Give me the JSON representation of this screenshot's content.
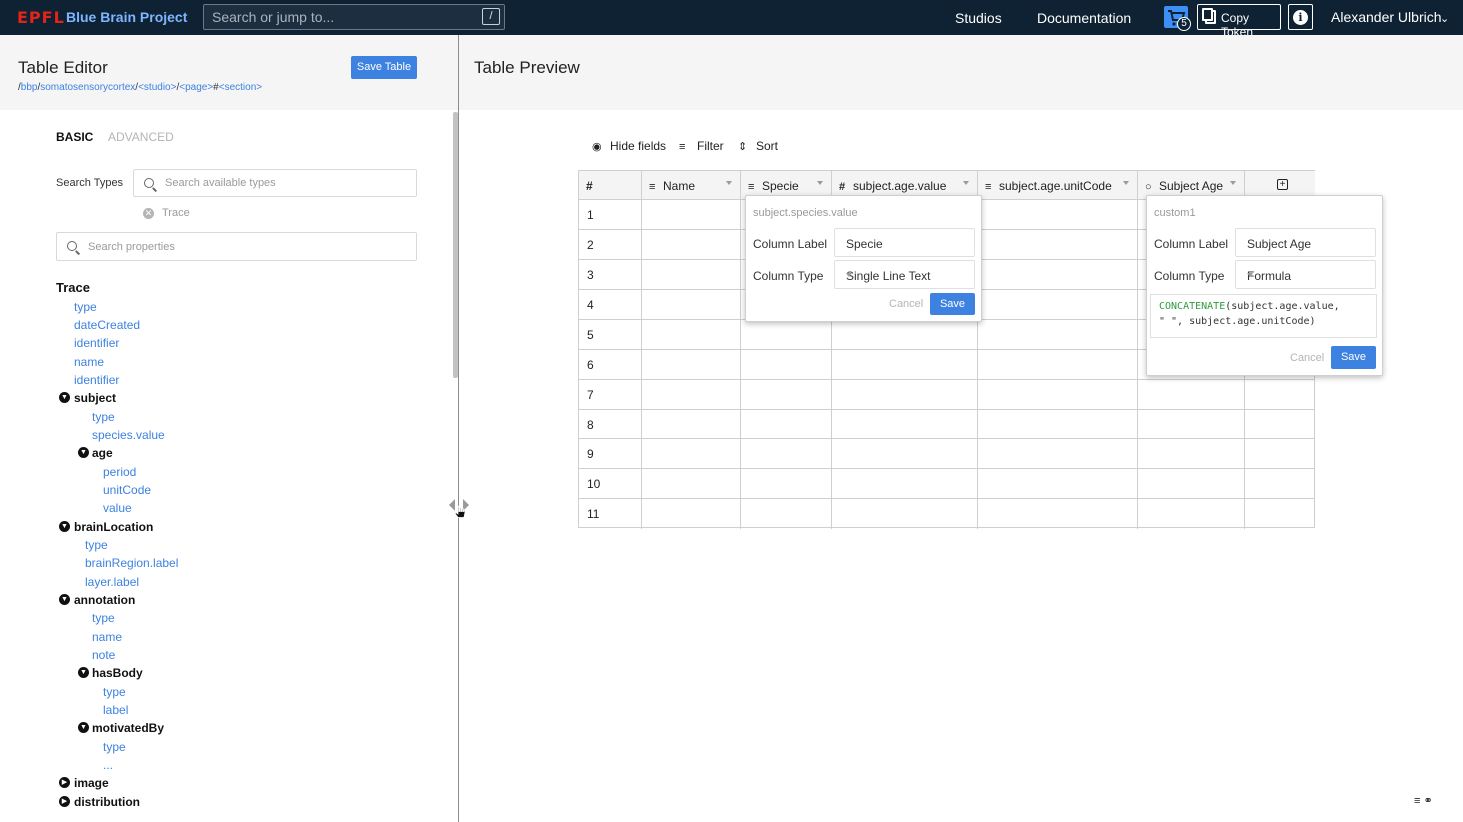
{
  "topbar": {
    "logo": "EPFL",
    "brand": "Blue Brain Project",
    "search_placeholder": "Search or jump to...",
    "search_shortcut": "/",
    "nav": [
      "Studios",
      "Documentation"
    ],
    "cart_count": "5",
    "copy_token": "Copy Token",
    "user": "Alexander Ulbrich"
  },
  "colors": {
    "topbar": "#0e2233",
    "accent": "#3d82e0",
    "logo": "#e1251b"
  },
  "editor": {
    "title": "Table Editor",
    "breadcrumb": [
      "/",
      "bbp",
      "/",
      "somatosensorycortex",
      "/",
      "<studio>",
      "/",
      "<page>",
      "#",
      "<section>"
    ],
    "save_table": "Save Table",
    "tabs": [
      "BASIC",
      "ADVANCED"
    ],
    "search_types_label": "Search Types",
    "search_types_placeholder": "Search available types",
    "selected_type": "Trace",
    "search_props_placeholder": "Search properties",
    "tree": [
      {
        "label": "Trace",
        "kind": "root"
      },
      {
        "label": "type",
        "kind": "link"
      },
      {
        "label": "dateCreated",
        "kind": "link"
      },
      {
        "label": "identifier",
        "kind": "link"
      },
      {
        "label": "name",
        "kind": "link"
      },
      {
        "label": "identifier",
        "kind": "link"
      },
      {
        "label": "subject",
        "kind": "group"
      },
      {
        "label": "type",
        "kind": "link"
      },
      {
        "label": "species.value",
        "kind": "link"
      },
      {
        "label": "age",
        "kind": "group"
      },
      {
        "label": "period",
        "kind": "link"
      },
      {
        "label": "unitCode",
        "kind": "link"
      },
      {
        "label": "value",
        "kind": "link"
      },
      {
        "label": "brainLocation",
        "kind": "group"
      },
      {
        "label": "type",
        "kind": "link"
      },
      {
        "label": "brainRegion.label",
        "kind": "link"
      },
      {
        "label": "layer.label",
        "kind": "link"
      },
      {
        "label": "annotation",
        "kind": "group"
      },
      {
        "label": "type",
        "kind": "link"
      },
      {
        "label": "name",
        "kind": "link"
      },
      {
        "label": "note",
        "kind": "link"
      },
      {
        "label": "hasBody",
        "kind": "group"
      },
      {
        "label": "type",
        "kind": "link"
      },
      {
        "label": "label",
        "kind": "link"
      },
      {
        "label": "motivatedBy",
        "kind": "group"
      },
      {
        "label": "type",
        "kind": "link"
      },
      {
        "label": "...",
        "kind": "link"
      },
      {
        "label": "image",
        "kind": "group"
      },
      {
        "label": "distribution",
        "kind": "group"
      }
    ]
  },
  "preview": {
    "title": "Table Preview",
    "toolbar": [
      "Hide fields",
      "Filter",
      "Sort"
    ],
    "columns": [
      {
        "label": "#",
        "type_icon": ""
      },
      {
        "label": "Name",
        "type_icon": "text-icon"
      },
      {
        "label": "Specie",
        "type_icon": "text-icon"
      },
      {
        "label": "subject.age.value",
        "type_icon": "number-icon"
      },
      {
        "label": "subject.age.unitCode",
        "type_icon": "text-icon"
      },
      {
        "label": "Subject Age",
        "type_icon": "formula-icon"
      }
    ],
    "rows": [
      "1",
      "2",
      "3",
      "4",
      "5",
      "6",
      "7",
      "8",
      "9",
      "10",
      "11"
    ],
    "popover_specie": {
      "field": "subject.species.value",
      "label_caption": "Column Label",
      "label_value": "Specie",
      "type_caption": "Column Type",
      "type_value": "Single Line Text",
      "cancel": "Cancel",
      "save": "Save"
    },
    "popover_custom": {
      "field": "custom1",
      "label_caption": "Column Label",
      "label_value": "Subject Age",
      "type_caption": "Column Type",
      "type_value": "Formula",
      "formula_fn": "CONCATENATE",
      "formula_line1": "(subject.age.value,",
      "formula_line2": "\" \", subject.age.unitCode)",
      "cancel": "Cancel",
      "save": "Save"
    }
  }
}
